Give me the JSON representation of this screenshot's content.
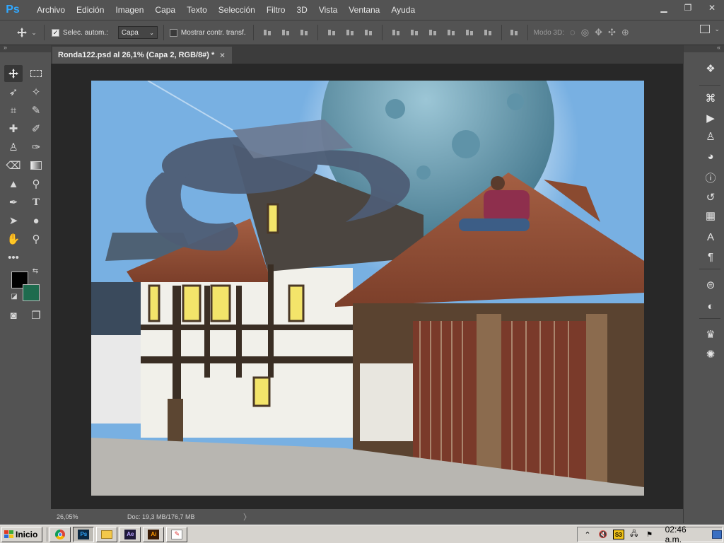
{
  "app": {
    "logo": "Ps"
  },
  "menu": [
    "Archivo",
    "Edición",
    "Imagen",
    "Capa",
    "Texto",
    "Selección",
    "Filtro",
    "3D",
    "Vista",
    "Ventana",
    "Ayuda"
  ],
  "window_controls": {
    "minimize": "▁",
    "restore": "❐",
    "close": "✕"
  },
  "options": {
    "auto_select_label": "Selec. autom.:",
    "auto_select_checked": true,
    "auto_select_target": "Capa",
    "show_transform_label": "Mostrar contr. transf.",
    "show_transform_checked": false,
    "mode_3d_label": "Modo 3D:"
  },
  "document_tab": {
    "title": "Ronda122.psd al 26,1% (Capa 2, RGB/8#) *",
    "close": "×"
  },
  "status": {
    "zoom": "26,05%",
    "doc_size": "Doc: 19,3 MB/176,7 MB",
    "arrow": "〉"
  },
  "colors": {
    "foreground": "#000000",
    "background": "#1e6b4e"
  },
  "taskbar": {
    "start_label": "Inicio",
    "apps": [
      "chrome-icon",
      "photoshop-icon",
      "explorer-icon",
      "after-effects-icon",
      "illustrator-icon",
      "paint-icon"
    ],
    "after_effects_label": "Ae",
    "illustrator_label": "Ai",
    "photoshop_label": "Ps",
    "tray_badge": "S3",
    "clock": "02:46 a.m."
  }
}
